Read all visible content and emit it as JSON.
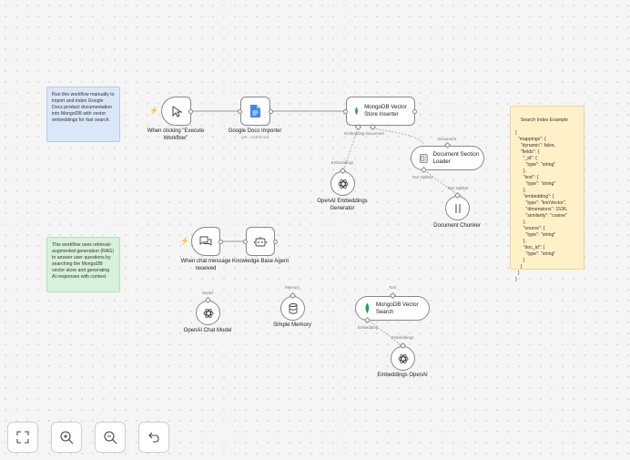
{
  "notes": {
    "import": "Run this workflow manually to import and index Google Docs product documentation into MongoDB with vector embeddings for fast search.",
    "rag": "This workflow uses retrieval-augmented generation (RAG) to answer user questions by searching the MongoDB vector store and generating AI responses with context.",
    "index_example": "Search Index Example\n\n{\n  \"mappings\": {\n    \"dynamic\": false,\n    \"fields\": {\n      \"_id\": {\n        \"type\": \"string\"\n      },\n      \"text\": {\n        \"type\": \"string\"\n      },\n      \"embedding\": {\n        \"type\": \"knnVector\",\n        \"dimensions\": 1536,\n        \"similarity\": \"cosine\"\n      },\n      \"source\": {\n        \"type\": \"string\"\n      },\n      \"doc_id\": {\n        \"type\": \"string\"\n      }\n    }\n  }\n}"
  },
  "nodes": {
    "manual_trigger": "When clicking \"Execute Workflow\"",
    "gdocs": "Google Docs Importer",
    "gdocs_sub": "get: undefined",
    "mongo_insert": "MongoDB Vector Store Inserter",
    "doc_loader": "Document Section Loader",
    "embeddings_gen": "OpenAI Embeddings Generator",
    "chunker": "Document Chunker",
    "chat_trigger": "When chat message received",
    "agent": "Knowledge Base Agent",
    "chat_model": "OpenAI Chat Model",
    "memory": "Simple Memory",
    "mongo_search": "MongoDB Vector Search",
    "embeddings_openai": "Embeddings OpenAI"
  },
  "ports": {
    "embedding_doc": "Embedding Document",
    "document": "Document",
    "embeddings": "Embeddings",
    "text_splitter_in": "Text Splitter",
    "text_splitter_out": "Text Splitter",
    "model": "Model",
    "memory": "Memory",
    "tool": "Tool",
    "embedding": "Embedding",
    "embeddings_2": "Embeddings"
  },
  "controls": {
    "fit": "fit-view",
    "zoom_in": "zoom-in",
    "zoom_out": "zoom-out",
    "undo": "undo"
  },
  "colors": {
    "trigger_bolt": "#ff6d5a",
    "google_docs": "#4285f4",
    "mongodb": "#13aa52",
    "note_blue": "#d9e7f7",
    "note_green": "#d8f1db",
    "note_yellow": "#fff1c7"
  }
}
